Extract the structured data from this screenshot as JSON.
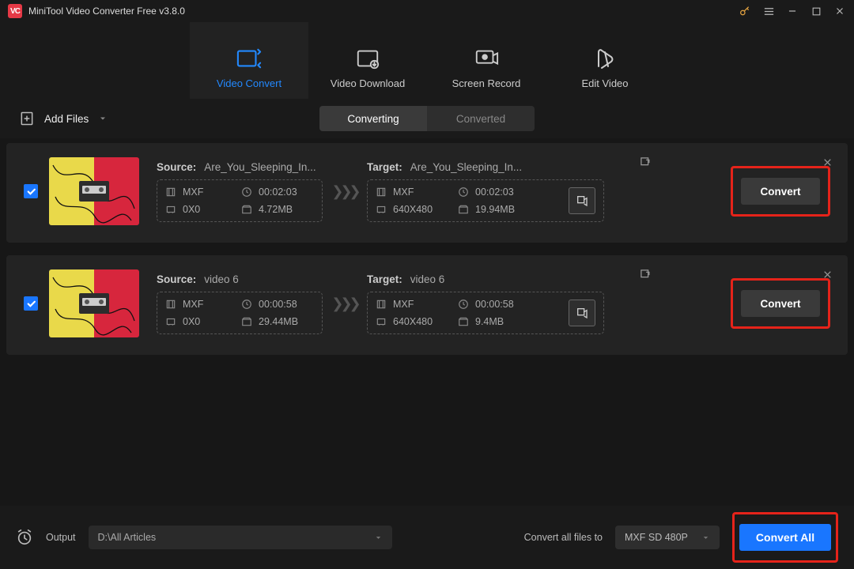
{
  "app": {
    "title": "MiniTool Video Converter Free v3.8.0",
    "logo_text": "VC"
  },
  "nav": {
    "tabs": [
      {
        "label": "Video Convert"
      },
      {
        "label": "Video Download"
      },
      {
        "label": "Screen Record"
      },
      {
        "label": "Edit Video"
      }
    ]
  },
  "toolbar": {
    "add_files": "Add Files",
    "seg_converting": "Converting",
    "seg_converted": "Converted"
  },
  "items": [
    {
      "source_label": "Source:",
      "source_name": "Are_You_Sleeping_In...",
      "target_label": "Target:",
      "target_name": "Are_You_Sleeping_In...",
      "src": {
        "fmt": "MXF",
        "dur": "00:02:03",
        "dim": "0X0",
        "size": "4.72MB"
      },
      "tgt": {
        "fmt": "MXF",
        "dur": "00:02:03",
        "dim": "640X480",
        "size": "19.94MB"
      },
      "btn": "Convert",
      "thumb": {
        "left": "#e9d94a",
        "right": "#d7263d"
      }
    },
    {
      "source_label": "Source:",
      "source_name": "video 6",
      "target_label": "Target:",
      "target_name": "video 6",
      "src": {
        "fmt": "MXF",
        "dur": "00:00:58",
        "dim": "0X0",
        "size": "29.44MB"
      },
      "tgt": {
        "fmt": "MXF",
        "dur": "00:00:58",
        "dim": "640X480",
        "size": "9.4MB"
      },
      "btn": "Convert",
      "thumb": {
        "left": "#e9d94a",
        "right": "#d7263d"
      }
    }
  ],
  "footer": {
    "output_label": "Output",
    "output_path": "D:\\All Articles",
    "convert_all_label": "Convert all files to",
    "profile": "MXF SD 480P",
    "convert_all_btn": "Convert All"
  }
}
